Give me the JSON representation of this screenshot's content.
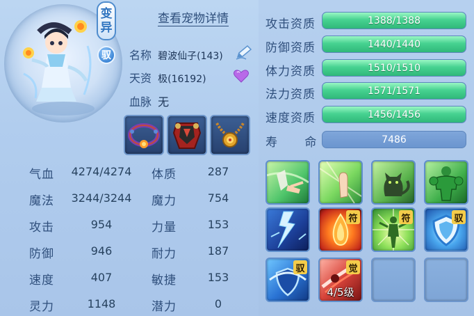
{
  "pet": {
    "badge_bian": "变",
    "badge_yi": "异",
    "badge_yu": "驭",
    "detail_link": "查看宠物详情",
    "name_label": "名称",
    "name_value": "碧波仙子(143)",
    "talent_label": "天资",
    "talent_value": "极(16192)",
    "blood_label": "血脉",
    "blood_value": "无"
  },
  "equipment": [
    {
      "icon": "bracelet-icon"
    },
    {
      "icon": "armor-icon"
    },
    {
      "icon": "necklace-icon"
    }
  ],
  "stats_left": [
    {
      "label": "气血",
      "value": "4274/4274"
    },
    {
      "label": "魔法",
      "value": "3244/3244"
    },
    {
      "label": "攻击",
      "value": "954"
    },
    {
      "label": "防御",
      "value": "946"
    },
    {
      "label": "速度",
      "value": "407"
    },
    {
      "label": "灵力",
      "value": "1148"
    }
  ],
  "stats_right": [
    {
      "label": "体质",
      "value": "287"
    },
    {
      "label": "魔力",
      "value": "754"
    },
    {
      "label": "力量",
      "value": "153"
    },
    {
      "label": "耐力",
      "value": "187"
    },
    {
      "label": "敏捷",
      "value": "153"
    },
    {
      "label": "潜力",
      "value": "0"
    }
  ],
  "aptitudes": [
    {
      "label": "攻击资质",
      "value": "1388/1388",
      "fill": 1.0
    },
    {
      "label": "防御资质",
      "value": "1440/1440",
      "fill": 1.0
    },
    {
      "label": "体力资质",
      "value": "1510/1510",
      "fill": 1.0
    },
    {
      "label": "法力资质",
      "value": "1571/1571",
      "fill": 1.0
    },
    {
      "label": "速度资质",
      "value": "1456/1456",
      "fill": 1.0
    }
  ],
  "lifespan": {
    "label_1": "寿",
    "label_2": "命",
    "value": "7486"
  },
  "skills": [
    {
      "icon": "finger-point-skill-icon",
      "tag": ""
    },
    {
      "icon": "palm-skill-icon",
      "tag": ""
    },
    {
      "icon": "cat-skill-icon",
      "tag": ""
    },
    {
      "icon": "strongman-skill-icon",
      "tag": ""
    },
    {
      "icon": "lightning-skill-icon",
      "tag": ""
    },
    {
      "icon": "fire-drop-skill-icon",
      "tag": "符"
    },
    {
      "icon": "figure-glow-skill-icon",
      "tag": "符"
    },
    {
      "icon": "shield-skill-icon",
      "tag": "驭"
    },
    {
      "icon": "shield-blue-skill-icon",
      "tag": "驭"
    },
    {
      "icon": "red-slash-skill-icon",
      "tag": "觉",
      "level": "4/5级"
    },
    {
      "icon": "empty-slot",
      "tag": ""
    },
    {
      "icon": "empty-slot",
      "tag": ""
    }
  ],
  "colors": {
    "bar_green": "#47d291",
    "bar_blue": "#6f9ad0",
    "panel_bg": "#b1cdee",
    "text_dark": "#2f4f7c"
  }
}
